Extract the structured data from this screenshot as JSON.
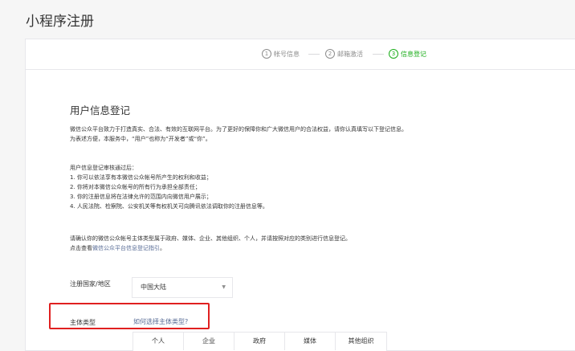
{
  "page": {
    "title": "小程序注册"
  },
  "steps": [
    {
      "num": "1",
      "label": "帐号信息",
      "active": false
    },
    {
      "num": "2",
      "label": "邮箱激活",
      "active": false
    },
    {
      "num": "3",
      "label": "信息登记",
      "active": true
    }
  ],
  "section": {
    "title": "用户信息登记"
  },
  "intro": {
    "line1": "微信公众平台致力于打造真实、合法、有效的互联网平台。为了更好的保障你和广大微信用户的合法权益，请你认真填写以下登记信息。",
    "line2": "为表述方便，本服务中，“用户”也称为“开发者”或“你”。"
  },
  "review": {
    "heading": "用户信息登记审核通过后：",
    "items": [
      "1. 你可以依法享有本微信公众帐号所产生的权利和收益；",
      "2. 你将对本微信公众帐号的所有行为承担全部责任；",
      "3. 你的注册信息将在法律允许的范围内向微信用户展示；",
      "4. 人民法院、检察院、公安机关等有权机关可向腾讯依法调取你的注册信息等。"
    ]
  },
  "confirm": {
    "line1": "请确认你的微信公众帐号主体类型属于政府、媒体、企业、其他组织、个人，并请按照对应的类别进行信息登记。",
    "line2_prefix": "点击查看",
    "line2_link": "微信公众平台信息登记指引",
    "line2_suffix": "。"
  },
  "form": {
    "region_label": "注册国家/地区",
    "region_value": "中国大陆",
    "subject_label": "主体类型",
    "subject_link": "如何选择主体类型?",
    "subject_types": [
      "个人",
      "企业",
      "政府",
      "媒体",
      "其他组织"
    ]
  },
  "colors": {
    "accent": "#1aad19",
    "link": "#576b95",
    "highlight": "#e02020"
  }
}
